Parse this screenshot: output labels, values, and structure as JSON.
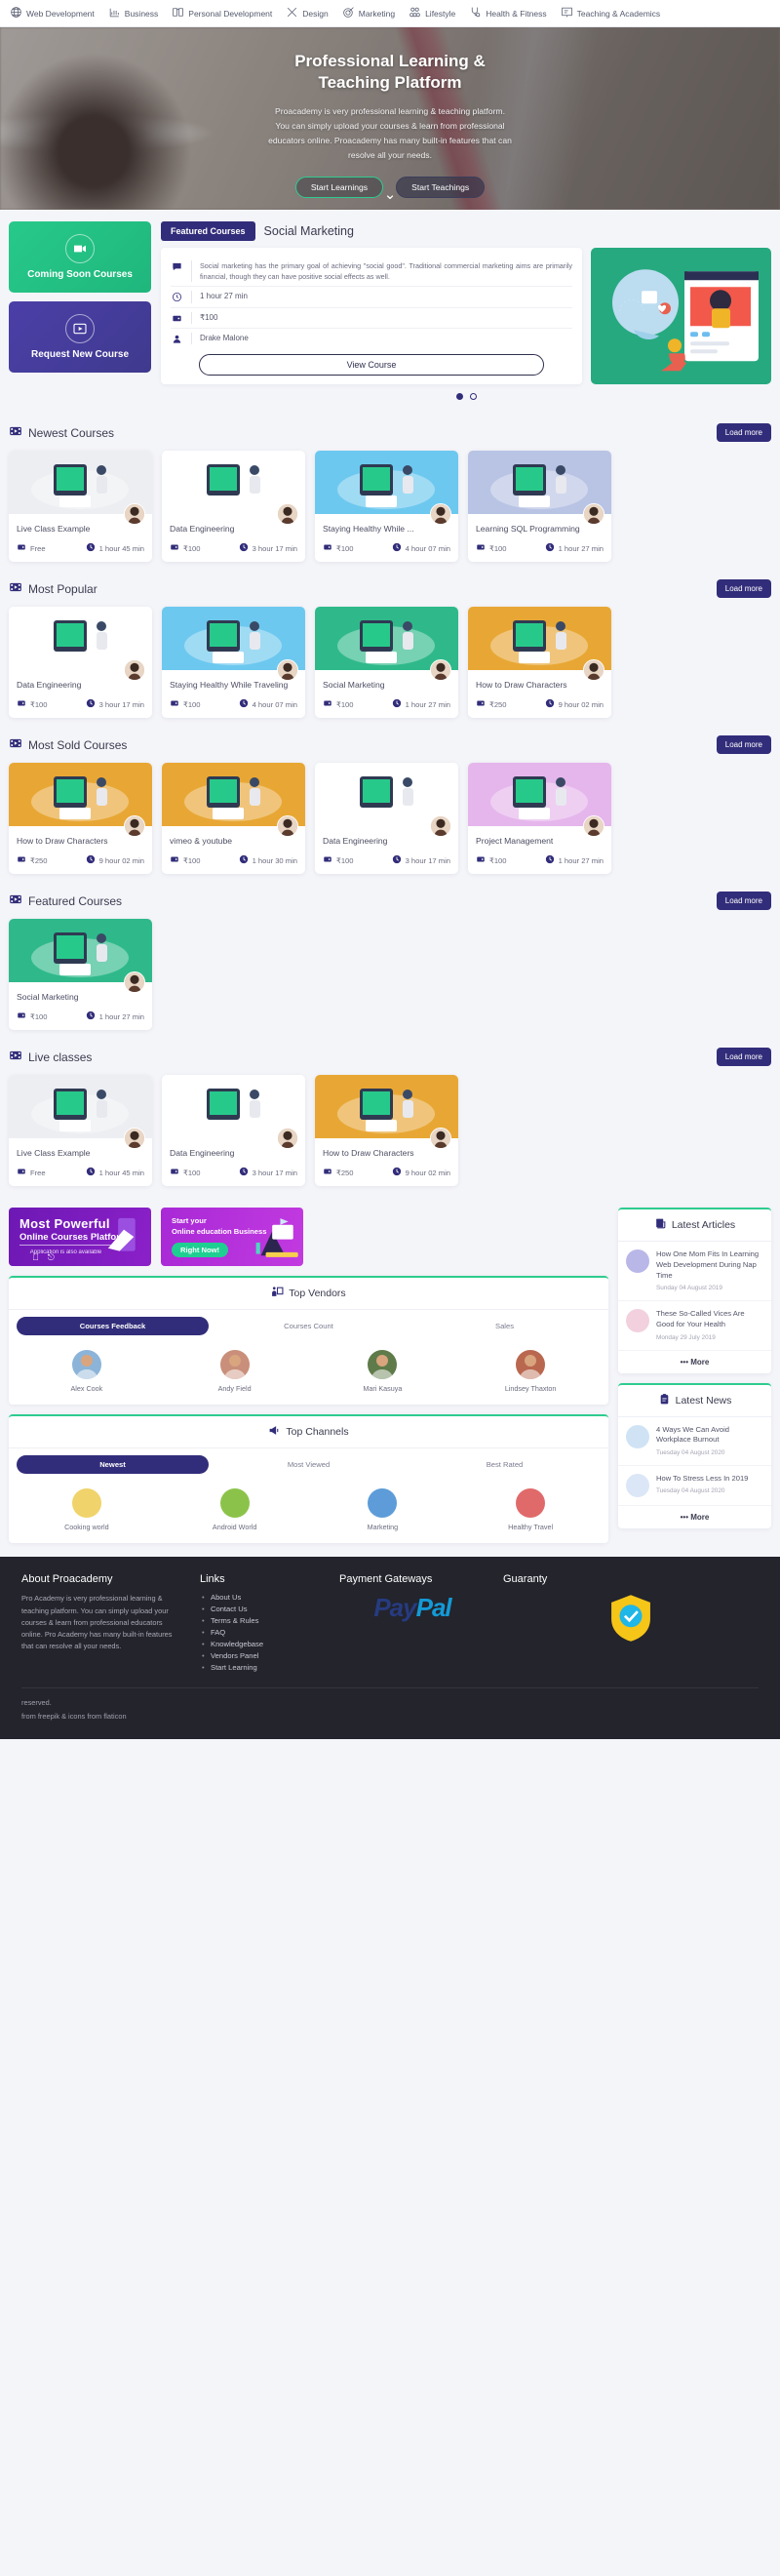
{
  "topnav": {
    "categories": [
      {
        "label": "Web Development",
        "icon": "globe-icon"
      },
      {
        "label": "Business",
        "icon": "chart-icon"
      },
      {
        "label": "Personal Development",
        "icon": "book-icon"
      },
      {
        "label": "Design",
        "icon": "pencil-ruler-icon"
      },
      {
        "label": "Marketing",
        "icon": "target-icon"
      },
      {
        "label": "Lifestyle",
        "icon": "people-icon"
      },
      {
        "label": "Health & Fitness",
        "icon": "stethoscope-icon"
      },
      {
        "label": "Teaching & Academics",
        "icon": "presentation-icon"
      }
    ]
  },
  "hero": {
    "title_line1": "Professional Learning &",
    "title_line2": "Teaching Platform",
    "description": "Proacademy is very professional learning & teaching platform. You can simply upload your courses & learn from professional educators online. Proacademy has many built-in features that can resolve all your needs.",
    "primary_button": "Start Learnings",
    "secondary_button": "Start Teachings",
    "scroll_icon": "chevron-down-icon"
  },
  "featured": {
    "tile_coming_soon": "Coming Soon Courses",
    "tile_request": "Request New Course",
    "tab_label": "Featured Courses",
    "course_title": "Social Marketing",
    "description": "Social marketing has the primary goal of achieving \"social good\". Traditional commercial marketing aims are primarily financial, though they can have positive social effects as well.",
    "duration": "1 hour 27 min",
    "price": "₹100",
    "author": "Drake Malone",
    "view_button": "View Course",
    "dots": 2,
    "active_dot": 0
  },
  "sections": [
    {
      "title": "Newest Courses",
      "load_more": "Load more",
      "courses": [
        {
          "name": "Live Class Example",
          "price": "Free",
          "duration": "1 hour 45 min",
          "color": "#eceef2"
        },
        {
          "name": "Data Engineering",
          "price": "₹100",
          "duration": "3 hour 17 min",
          "color": "#ffffff"
        },
        {
          "name": "Staying Healthy While ...",
          "price": "₹100",
          "duration": "4 hour 07 min",
          "color": "#6dc8ef"
        },
        {
          "name": "Learning SQL Programming",
          "price": "₹100",
          "duration": "1 hour 27 min",
          "color": "#b9c4e4"
        }
      ]
    },
    {
      "title": "Most Popular",
      "load_more": "Load more",
      "courses": [
        {
          "name": "Data Engineering",
          "price": "₹100",
          "duration": "3 hour 17 min",
          "color": "#ffffff"
        },
        {
          "name": "Staying Healthy While Traveling",
          "price": "₹100",
          "duration": "4 hour 07 min",
          "color": "#6dc8ef"
        },
        {
          "name": "Social Marketing",
          "price": "₹100",
          "duration": "1 hour 27 min",
          "color": "#2fb98a"
        },
        {
          "name": "How to Draw Characters",
          "price": "₹250",
          "duration": "9 hour 02 min",
          "color": "#e8a735"
        }
      ]
    },
    {
      "title": "Most Sold Courses",
      "load_more": "Load more",
      "courses": [
        {
          "name": "How to Draw Characters",
          "price": "₹250",
          "duration": "9 hour 02 min",
          "color": "#e8a735"
        },
        {
          "name": "vimeo & youtube",
          "price": "₹100",
          "duration": "1 hour 30 min",
          "color": "#e8a735"
        },
        {
          "name": "Data Engineering",
          "price": "₹100",
          "duration": "3 hour 17 min",
          "color": "#ffffff"
        },
        {
          "name": "Project Management",
          "price": "₹100",
          "duration": "1 hour 27 min",
          "color": "#e5b6ec"
        }
      ]
    },
    {
      "title": "Featured Courses",
      "load_more": "Load more",
      "courses": [
        {
          "name": "Social Marketing",
          "price": "₹100",
          "duration": "1 hour 27 min",
          "color": "#2fb98a"
        }
      ]
    },
    {
      "title": "Live classes",
      "load_more": "Load more",
      "courses": [
        {
          "name": "Live Class Example",
          "price": "Free",
          "duration": "1 hour 45 min",
          "color": "#eceef2"
        },
        {
          "name": "Data Engineering",
          "price": "₹100",
          "duration": "3 hour 17 min",
          "color": "#ffffff"
        },
        {
          "name": "How to Draw Characters",
          "price": "₹250",
          "duration": "9 hour 02 min",
          "color": "#e8a735"
        }
      ]
    }
  ],
  "banners": {
    "left": {
      "line1": "Most Powerful",
      "line2": "Online Courses Platform",
      "line3": "Application is also available"
    },
    "right": {
      "line1": "Start your",
      "line2": "Online education Business",
      "cta": "Right Now!"
    }
  },
  "vendors": {
    "title": "Top Vendors",
    "icon": "vendor-icon",
    "tabs": [
      "Courses Feedback",
      "Courses Count",
      "Sales"
    ],
    "active_tab": 0,
    "people": [
      {
        "name": "Alex Cook",
        "color": "#8cb4d8"
      },
      {
        "name": "Andy Field",
        "color": "#c98f7a"
      },
      {
        "name": "Mari Kasuya",
        "color": "#5f7b4a"
      },
      {
        "name": "Lindsey Thaxton",
        "color": "#b9684f"
      }
    ]
  },
  "channels": {
    "title": "Top Channels",
    "icon": "megaphone-icon",
    "tabs": [
      "Newest",
      "Most Viewed",
      "Best Rated"
    ],
    "active_tab": 0,
    "items": [
      {
        "name": "Cooking world",
        "color": "#f0d36a"
      },
      {
        "name": "Android World",
        "color": "#8bc34a"
      },
      {
        "name": "Marketing",
        "color": "#5d9cd8"
      },
      {
        "name": "Healthy Travel",
        "color": "#e06a6a"
      }
    ]
  },
  "articles": {
    "title": "Latest Articles",
    "icon": "article-icon",
    "items": [
      {
        "title": "How One Mom Fits In Learning Web Development During Nap Time",
        "date": "Sunday 04 August 2019",
        "color": "#b9b7e8"
      },
      {
        "title": "These So-Called Vices Are Good for Your Health",
        "date": "Monday 29 July 2019",
        "color": "#f2d0de"
      }
    ],
    "more": "More"
  },
  "news": {
    "title": "Latest News",
    "icon": "clipboard-icon",
    "items": [
      {
        "title": "4 Ways We Can Avoid Workplace Burnout",
        "date": "Tuesday 04 August 2020",
        "color": "#cfe3f5"
      },
      {
        "title": "How To Stress Less In 2019",
        "date": "Tuesday 04 August 2020",
        "color": "#dbe7f7"
      }
    ],
    "more": "More"
  },
  "footer": {
    "about_title": "About Proacademy",
    "about_text": "Pro Academy is very professional learning & teaching platform. You can simply upload your courses & learn from professional educators online. Pro Academy has many built-in features that can resolve all your needs.",
    "links_title": "Links",
    "links": [
      "About Us",
      "Contact Us",
      "Terms & Rules",
      "FAQ",
      "Knowledgebase",
      "Vendors Panel",
      "Start Learning"
    ],
    "payment_title": "Payment Gateways",
    "paypal_pay": "Pay",
    "paypal_pal": "Pal",
    "guaranty_title": "Guaranty",
    "copyright": "reserved.",
    "credits": "from freepik & icons from flaticon"
  },
  "colors": {
    "primary": "#322d7a",
    "accent_green": "#2ecc8f",
    "page_bg": "#f4f5f9"
  }
}
